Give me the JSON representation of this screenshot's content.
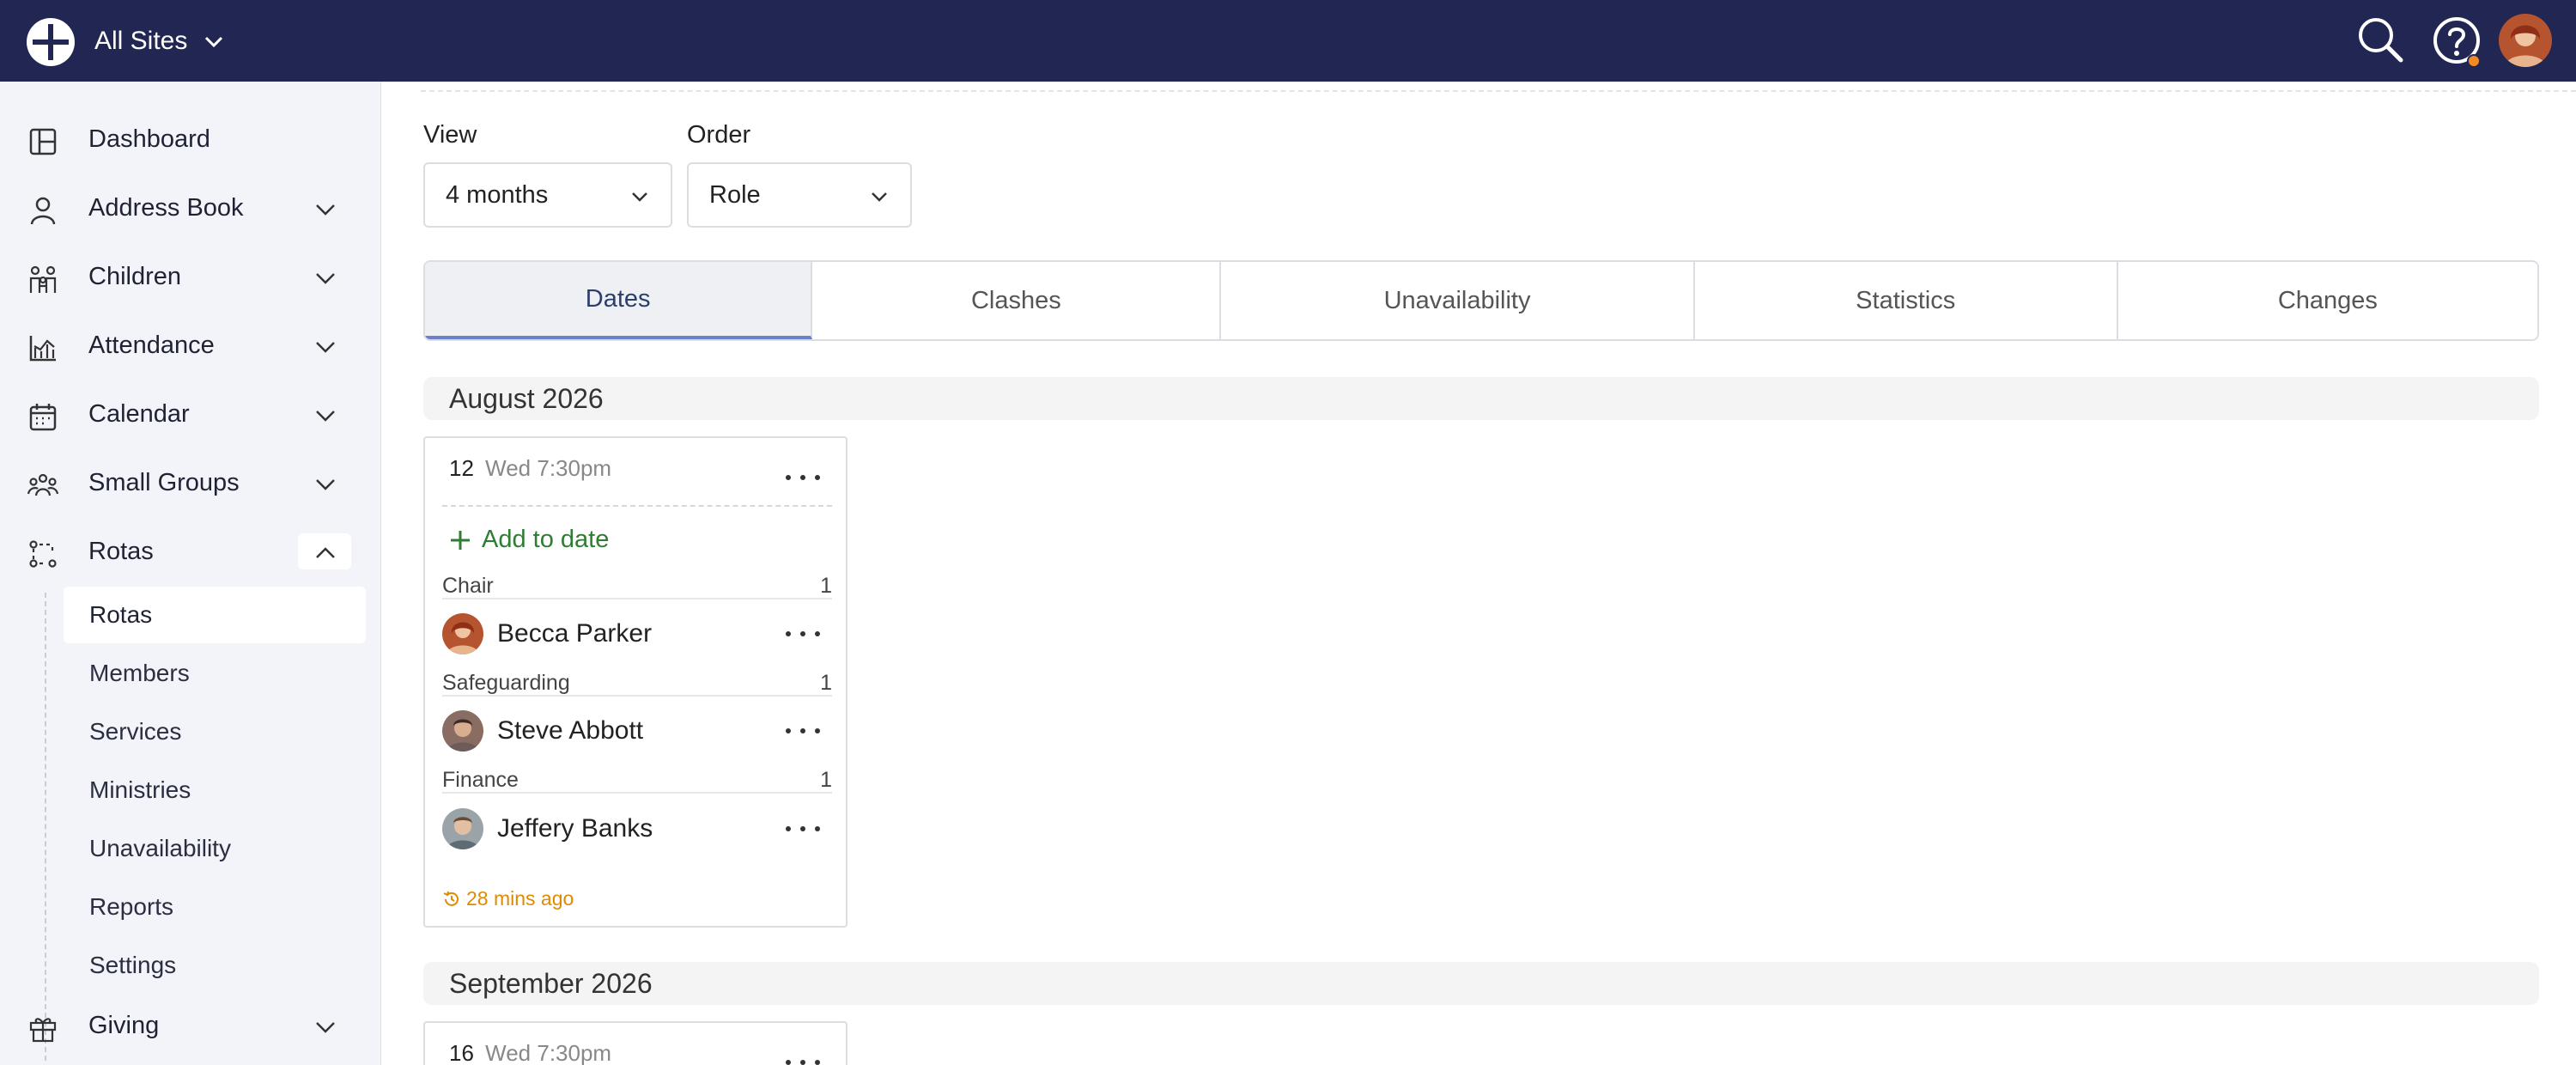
{
  "topbar": {
    "site_label": "All Sites",
    "icons": [
      "logo-icon",
      "chevron-down-icon",
      "search-icon",
      "help-icon",
      "avatar"
    ],
    "bg_color": "#212752",
    "notification_color": "#f08a24"
  },
  "sidebar": {
    "items": [
      {
        "label": "Dashboard",
        "icon": "dashboard-icon"
      },
      {
        "label": "Address Book",
        "icon": "person-icon"
      },
      {
        "label": "Children",
        "icon": "children-icon"
      },
      {
        "label": "Attendance",
        "icon": "chart-icon"
      },
      {
        "label": "Calendar",
        "icon": "calendar-icon"
      },
      {
        "label": "Small Groups",
        "icon": "groups-icon"
      },
      {
        "label": "Rotas",
        "icon": "rota-icon"
      },
      {
        "label": "Giving",
        "icon": "gift-icon"
      }
    ],
    "subitems": [
      "Rotas",
      "Members",
      "Services",
      "Ministries",
      "Unavailability",
      "Reports",
      "Settings"
    ]
  },
  "filters": {
    "view_label": "View",
    "view_value": "4 months",
    "order_label": "Order",
    "order_value": "Role"
  },
  "tabs": [
    "Dates",
    "Clashes",
    "Unavailability",
    "Statistics",
    "Changes"
  ],
  "months": [
    {
      "title": "August 2026",
      "card": {
        "day": "12",
        "when": "Wed 7:30pm",
        "add_label": "Add to date",
        "roles": [
          {
            "name": "Chair",
            "count": "1",
            "person": "Becca Parker"
          },
          {
            "name": "Safeguarding",
            "count": "1",
            "person": "Steve Abbott"
          },
          {
            "name": "Finance",
            "count": "1",
            "person": "Jeffery Banks"
          }
        ],
        "updated": "28 mins ago"
      }
    },
    {
      "title": "September 2026",
      "card": {
        "day": "16",
        "when": "Wed 7:30pm"
      }
    }
  ],
  "colors": {
    "accent_tab": "#6a80c8",
    "add_green": "#2e7d32",
    "timeago_orange": "#e08a00"
  }
}
